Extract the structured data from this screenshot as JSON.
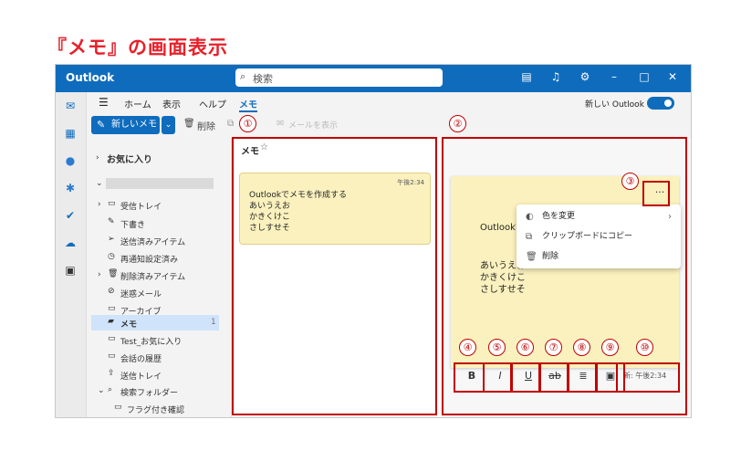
{
  "heading": "『メモ』の画面表示",
  "app_title": "Outlook",
  "search": {
    "placeholder": "検索"
  },
  "titlebar_icons": [
    "note-icon",
    "bell-icon",
    "gear-icon",
    "minimize-icon",
    "maximize-icon",
    "close-icon"
  ],
  "menu": {
    "tabs": [
      "ホーム",
      "表示",
      "ヘルプ",
      "メモ"
    ],
    "active": "メモ",
    "new_outlook": "新しい Outlook"
  },
  "toolbar": {
    "new_note": "新しいメモ",
    "delete": "削除",
    "email": "メールを表示"
  },
  "nav": {
    "favorites": "お気に入り",
    "folders": [
      "受信トレイ",
      "下書き",
      "送信済みアイテム",
      "再通知設定済み",
      "削除済みアイテム",
      "迷惑メール",
      "アーカイブ",
      "メモ",
      "Test_お気に入り",
      "会話の履歴",
      "送信トレイ",
      "検索フォルダー",
      "フラグ付き確認"
    ],
    "memo_count": "1"
  },
  "list": {
    "title": "メモ",
    "note": {
      "time": "午後2:34",
      "lines": [
        "Outlookでメモを作成する",
        "あいうえお",
        "かきくけこ",
        "さしすせそ"
      ]
    }
  },
  "detail": {
    "lines": [
      "Outlookでメモを作成す",
      "あいうえお",
      "かきくけこ",
      "さしすせそ"
    ],
    "more": "···",
    "context_menu": [
      "色を変更",
      "クリップボードにコピー",
      "削除"
    ],
    "format_buttons": [
      "B",
      "I",
      "U",
      "ab",
      "≣",
      "▣"
    ],
    "timestamp": "新: 午後2:34"
  },
  "callouts": [
    "①",
    "②",
    "③",
    "④",
    "⑤",
    "⑥",
    "⑦",
    "⑧",
    "⑨",
    "⑩"
  ],
  "colors": {
    "accent": "#0f6cbd",
    "note": "#fbf1be",
    "annotation": "#c00000",
    "heading": "#e8202a"
  }
}
